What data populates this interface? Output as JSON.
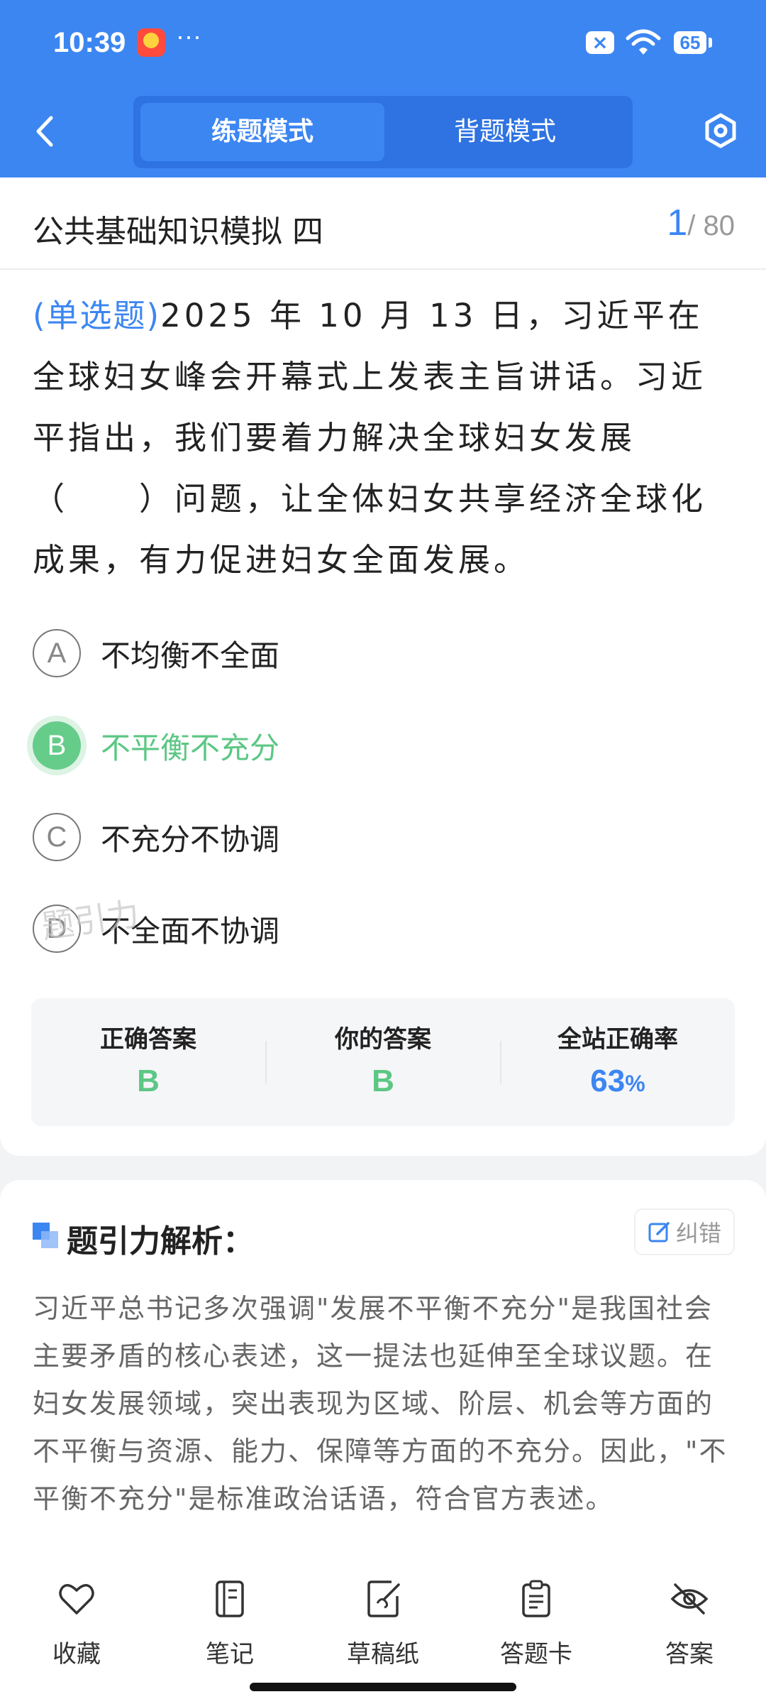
{
  "status_bar": {
    "time": "10:39",
    "dots": "···",
    "battery": "65"
  },
  "header": {
    "tabs": [
      {
        "label": "练题模式",
        "active": true
      },
      {
        "label": "背题模式",
        "active": false
      }
    ]
  },
  "paper": {
    "title": "公共基础知识模拟 四",
    "current": "1",
    "total": "/ 80"
  },
  "question": {
    "type_label": "(单选题)",
    "text": "2025 年 10 月 13 日，习近平在全球妇女峰会开幕式上发表主旨讲话。习近平指出，我们要着力解决全球妇女发展（　　）问题，让全体妇女共享经济全球化成果，有力促进妇女全面发展。"
  },
  "options": [
    {
      "letter": "A",
      "text": "不均衡不全面"
    },
    {
      "letter": "B",
      "text": "不平衡不充分"
    },
    {
      "letter": "C",
      "text": "不充分不协调"
    },
    {
      "letter": "D",
      "text": "不全面不协调"
    }
  ],
  "selected_option": "B",
  "watermark": "题引力",
  "result": {
    "correct_label": "正确答案",
    "correct_value": "B",
    "yours_label": "你的答案",
    "yours_value": "B",
    "rate_label": "全站正确率",
    "rate_value": "63",
    "rate_unit": "%"
  },
  "analysis": {
    "title": "题引力解析：",
    "report_label": "纠错",
    "text": "习近平总书记多次强调\"发展不平衡不充分\"是我国社会主要矛盾的核心表述，这一提法也延伸至全球议题。在妇女发展领域，突出表现为区域、阶层、机会等方面的不平衡与资源、能力、保障等方面的不充分。因此，\"不平衡不充分\"是标准政治话语，符合官方表述。"
  },
  "bottom_nav": [
    {
      "label": "收藏",
      "icon": "heart-icon"
    },
    {
      "label": "笔记",
      "icon": "notebook-icon"
    },
    {
      "label": "草稿纸",
      "icon": "draft-icon"
    },
    {
      "label": "答题卡",
      "icon": "clipboard-icon"
    },
    {
      "label": "答案",
      "icon": "eye-off-icon"
    }
  ],
  "colors": {
    "primary": "#3c86f2",
    "correct": "#5cc784"
  }
}
